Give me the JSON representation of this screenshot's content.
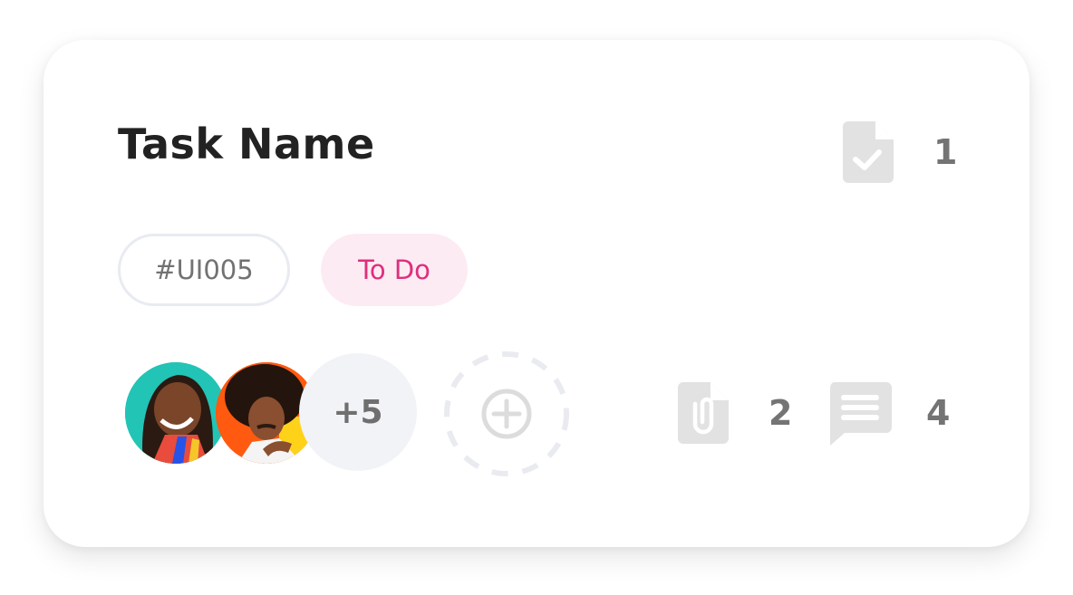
{
  "card": {
    "title": "Task Name",
    "subtasks_count": "1",
    "task_id": "#UI005",
    "status": "To Do",
    "status_color": "#de2f7d",
    "status_bg": "#fdebf3",
    "more_assignees": "+5",
    "attachments_count": "2",
    "comments_count": "4",
    "icons": {
      "subtasks": "document-check-icon",
      "add_assignee": "add-circle-icon",
      "attachments": "document-paperclip-icon",
      "comments": "comment-icon"
    }
  }
}
